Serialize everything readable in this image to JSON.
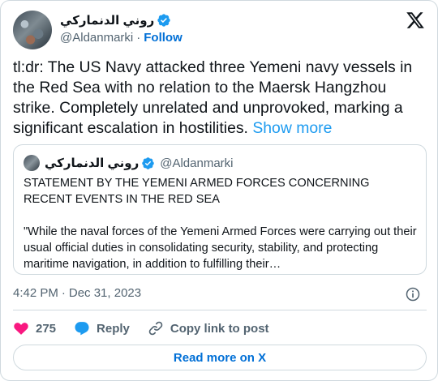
{
  "author": {
    "display_name": "روني الدنماركي",
    "handle": "@Aldanmarki",
    "separator": "·",
    "follow_label": "Follow"
  },
  "tweet": {
    "text": "tl:dr: The US Navy attacked three Yemeni navy vessels in the Red Sea with no relation to the Maersk Hangzhou strike. Completely unrelated and unprovoked, marking a significant escalation in hostilities.",
    "show_more_label": "Show more"
  },
  "quote": {
    "display_name": "روني الدنماركي",
    "handle": "@Aldanmarki",
    "heading": "STATEMENT BY THE YEMENI ARMED FORCES CONCERNING RECENT EVENTS IN THE RED SEA",
    "body": "\"While the naval forces of the Yemeni Armed Forces were carrying out their usual official duties in consolidating security, stability, and protecting maritime navigation, in addition to fulfilling their…"
  },
  "meta": {
    "time": "4:42 PM",
    "separator": "·",
    "date": "Dec 31, 2023"
  },
  "actions": {
    "like_count": "275",
    "reply_label": "Reply",
    "copy_link_label": "Copy link to post"
  },
  "footer": {
    "read_more_label": "Read more on X"
  },
  "colors": {
    "link": "#006fd6",
    "show_more": "#1d9bf0",
    "verified": "#1d9bf0",
    "like": "#f91880",
    "reply": "#1d9bf0",
    "secondary_text": "#536471",
    "border": "#cfd9de"
  },
  "icons": [
    "verified-badge-icon",
    "x-logo-icon",
    "info-icon",
    "heart-icon",
    "reply-bubble-icon",
    "link-icon"
  ]
}
